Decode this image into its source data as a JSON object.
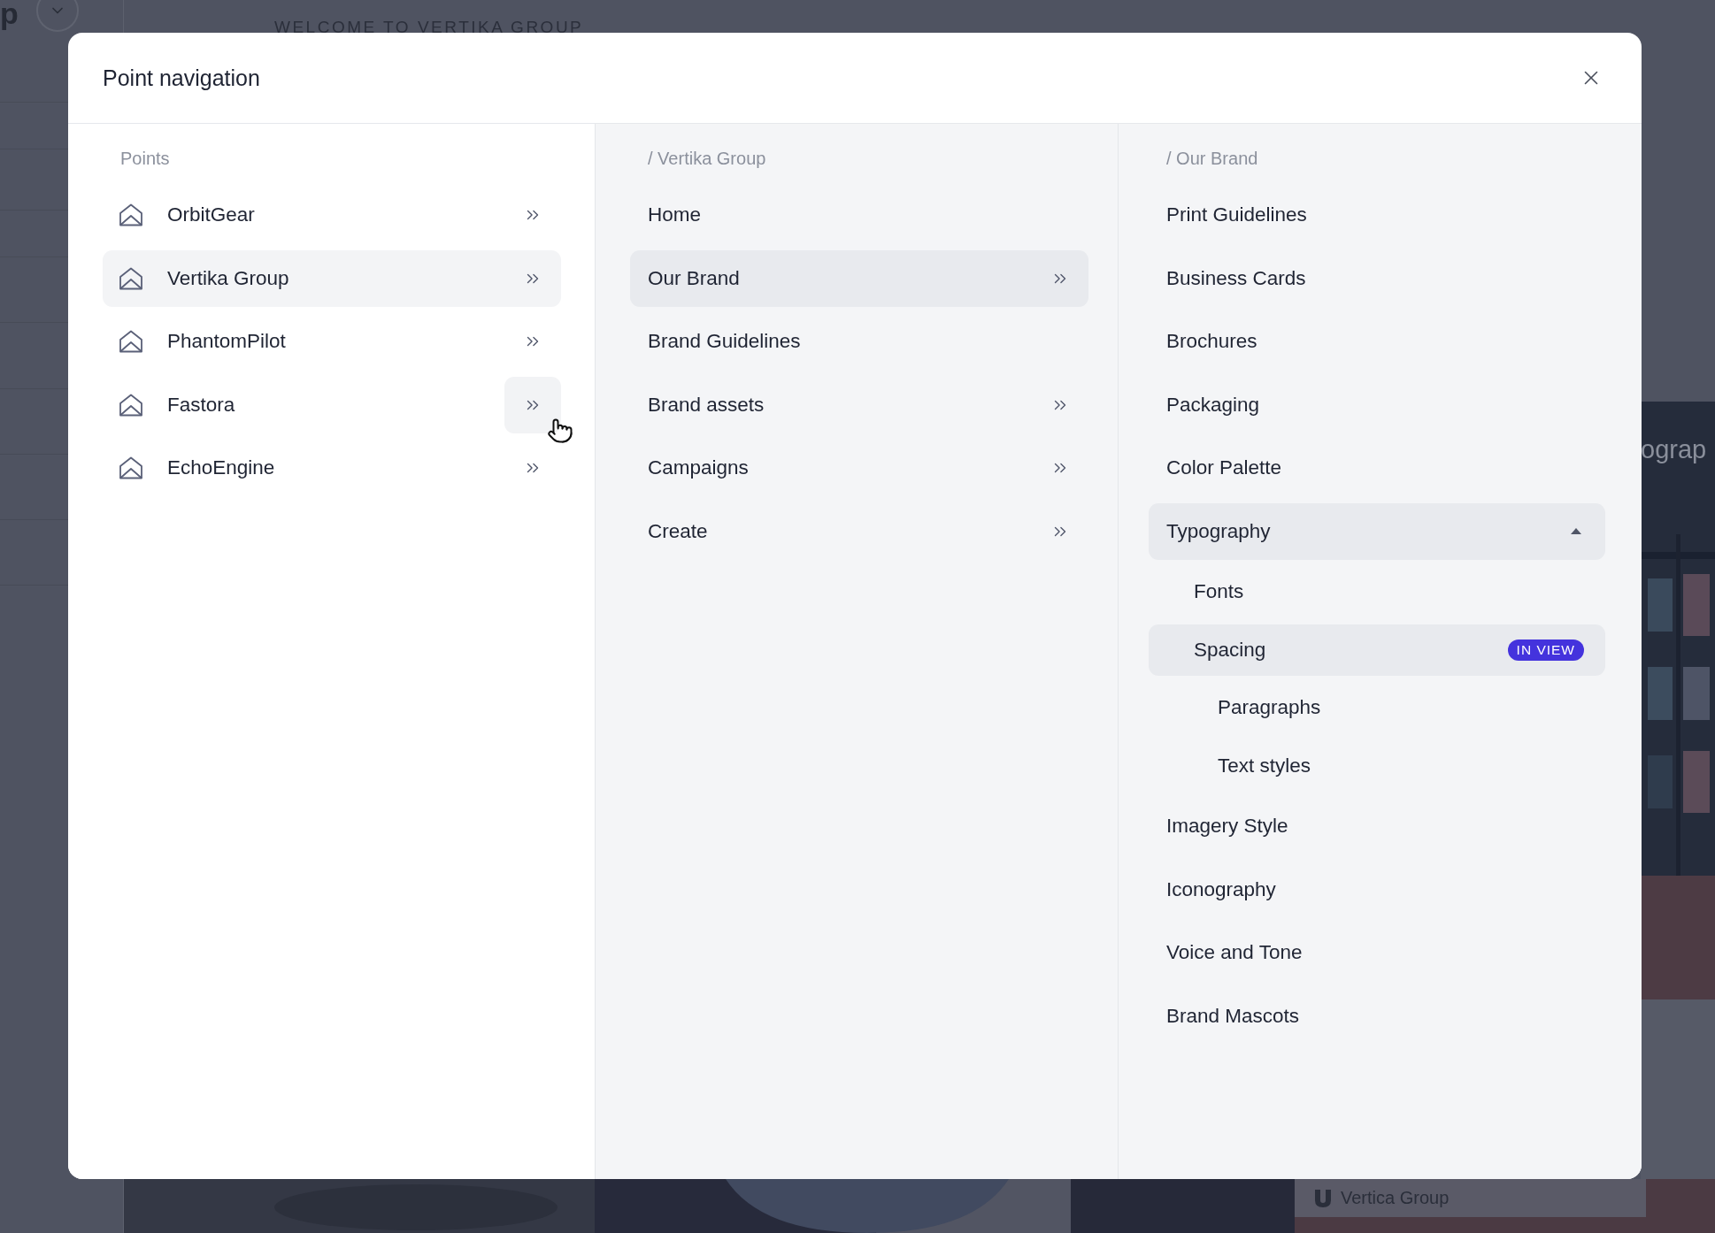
{
  "background": {
    "logo_text": "p",
    "welcome": "WELCOME TO VERTIKA GROUP",
    "hero_text": "ograp",
    "footer_card": "Vertica Group"
  },
  "modal": {
    "title": "Point navigation"
  },
  "points": {
    "label": "Points",
    "items": [
      {
        "name": "OrbitGear",
        "selected": false,
        "chevron_hovered": false
      },
      {
        "name": "Vertika Group",
        "selected": true,
        "chevron_hovered": false
      },
      {
        "name": "PhantomPilot",
        "selected": false,
        "chevron_hovered": false
      },
      {
        "name": "Fastora",
        "selected": false,
        "chevron_hovered": true
      },
      {
        "name": "EchoEngine",
        "selected": false,
        "chevron_hovered": false
      }
    ]
  },
  "sections": {
    "label": "/ Vertika Group",
    "items": [
      {
        "name": "Home",
        "selected": false,
        "has_children": false
      },
      {
        "name": "Our Brand",
        "selected": true,
        "has_children": true
      },
      {
        "name": "Brand Guidelines",
        "selected": false,
        "has_children": false
      },
      {
        "name": "Brand assets",
        "selected": false,
        "has_children": true
      },
      {
        "name": "Campaigns",
        "selected": false,
        "has_children": true
      },
      {
        "name": "Create",
        "selected": false,
        "has_children": true
      }
    ]
  },
  "pages": {
    "label": "/ Our Brand",
    "items": [
      {
        "name": "Print Guidelines",
        "selected": false
      },
      {
        "name": "Business Cards",
        "selected": false
      },
      {
        "name": "Brochures",
        "selected": false
      },
      {
        "name": "Packaging",
        "selected": false
      },
      {
        "name": "Color Palette",
        "selected": false
      },
      {
        "name": "Typography",
        "selected": true,
        "expanded": true,
        "children": [
          {
            "name": "Fonts",
            "selected": false
          },
          {
            "name": "Spacing",
            "selected": true,
            "badge": "IN VIEW",
            "children": [
              {
                "name": "Paragraphs",
                "selected": false
              },
              {
                "name": "Text styles",
                "selected": false
              }
            ]
          }
        ]
      },
      {
        "name": "Imagery Style",
        "selected": false
      },
      {
        "name": "Iconography",
        "selected": false
      },
      {
        "name": "Voice and Tone",
        "selected": false
      },
      {
        "name": "Brand Mascots",
        "selected": false
      }
    ]
  }
}
